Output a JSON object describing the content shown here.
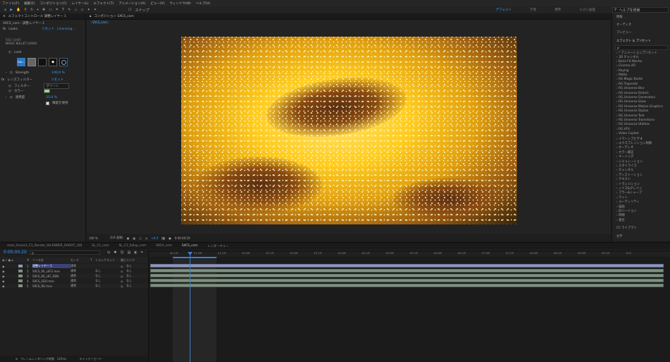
{
  "menu": [
    "ファイル(F)",
    "編集(E)",
    "コンポジション(C)",
    "レイヤー(L)",
    "エフェクト(T)",
    "アニメーション(A)",
    "ビュー(V)",
    "ウィンドウ(W)",
    "ヘルプ(H)"
  ],
  "toolbar": {
    "snap_label": "スナップ",
    "workspaces": [
      "デフォルト",
      "学習",
      "標準",
      "小さい画面",
      "ライブラリ"
    ],
    "help_search": "ヘルプを検索"
  },
  "left_panel": {
    "tab_label": "エフェクトコントロール 調整レイヤー 1",
    "layer_path": "SXCS_com・調整レイヤー 1",
    "effect_name": "Looks",
    "effect_links": [
      "リセット",
      "Licensing..."
    ],
    "brand_line1": "RED GIANT",
    "brand_line2": "MAGIC BULLET LOOKS",
    "look_label": "Look",
    "edit_button": "Edit...",
    "strength_label": "Strength",
    "strength_value": "100.0 %",
    "lens_filter": "レンズフィルター",
    "lens_reset": "リセット",
    "filter_label": "フィルター",
    "filter_value": "グリーン",
    "color_label": "カラー",
    "density_label": "適用度",
    "density_value": "25.0 %",
    "preserve_label": "輝度を保持"
  },
  "viewer": {
    "tab_label": "コンポジション SXCS_com",
    "sub_tab": "SXCS_com",
    "zoom": "100 %",
    "resolution": "(1/4 画質)",
    "timecode": "0:00:00:20",
    "exposure": "+0.0"
  },
  "right_panel": {
    "items": [
      "情報",
      "オーディオ",
      "プレビュー",
      "エフェクト & プリセット"
    ],
    "search_placeholder": "ρ-",
    "tree": [
      "* アニメーションプリセット",
      "3D チャンネル",
      "Boris FX Mocha",
      "Cinema 4D",
      "Keying",
      "Matte",
      "RG Magic Bullet",
      "RG Trapcode",
      "RG Universe Blur",
      "RG Universe Distort",
      "RG Universe Generators",
      "RG Universe Glow",
      "RG Universe Motion Graphics",
      "RG Universe Stylize",
      "RG Universe Text",
      "RG Universe Transitions",
      "RG Universe Utilities",
      "RG VFX",
      "Video Copilot",
      "イマーシブビデオ",
      "エクスプレッション制御",
      "オーディオ",
      "カラー補正",
      "キーイング",
      "シミュレーション",
      "スタイライズ",
      "チャンネル",
      "ディストーション",
      "テキスト",
      "トランジション",
      "ノイズ&グレイン",
      "ブラー&シャープ",
      "マット",
      "ユーティリティ",
      "描画",
      "旧バージョン",
      "時間",
      "遠近"
    ],
    "libraries": "CC ライブラリ",
    "chars": "文字"
  },
  "timeline": {
    "tabs": [
      "main_Scene1_C1_Render_HA-ENDER_SHOOT_c00",
      "SL_C1_com",
      "SL_C1_fullup_com",
      "SXCA_com",
      "SXCS_com",
      "レンダーキュー"
    ],
    "active_tab": 4,
    "timecode": "0:00:00:20",
    "col_headers": [
      "#",
      "ソース名",
      "モード",
      "T",
      "トラックマット",
      "親とリンク"
    ],
    "layers": [
      {
        "num": "1",
        "name": "調整レイヤー 1",
        "mode": "通常",
        "matte": "",
        "parent": "なし"
      },
      {
        "num": "2",
        "name": "SXCS_RE_LEF2.mov",
        "mode": "通常",
        "matte": "なし",
        "parent": "なし"
      },
      {
        "num": "3",
        "name": "SXCS_RE_LEF_REN",
        "mode": "通常",
        "matte": "なし",
        "parent": "なし"
      },
      {
        "num": "4",
        "name": "SXCS_GEO.mov",
        "mode": "通常",
        "matte": "なし",
        "parent": "なし"
      },
      {
        "num": "5",
        "name": "SXCS_BG.mov",
        "mode": "通常",
        "matte": "なし",
        "parent": "なし"
      }
    ],
    "ruler": [
      "00:12f",
      "01:00f",
      "01:12f",
      "02:00f",
      "02:12f",
      "03:00f",
      "03:12f",
      "04:00f",
      "04:12f",
      "05:00f",
      "05:12f",
      "06:00f",
      "06:12f",
      "07:00f",
      "07:12f",
      "08:00f",
      "08:12f",
      "09:00f",
      "09:12f",
      "10:0"
    ],
    "footer_render": "フレームレンダリング時間",
    "footer_time": "125ms",
    "footer_switch": "スイッチ / モード"
  },
  "colors": {
    "accent": "#3aa0ff",
    "playhead": "#3a7fd0",
    "layer_bar": "#7e9080",
    "adjustment_bar": "#8e96b8"
  }
}
